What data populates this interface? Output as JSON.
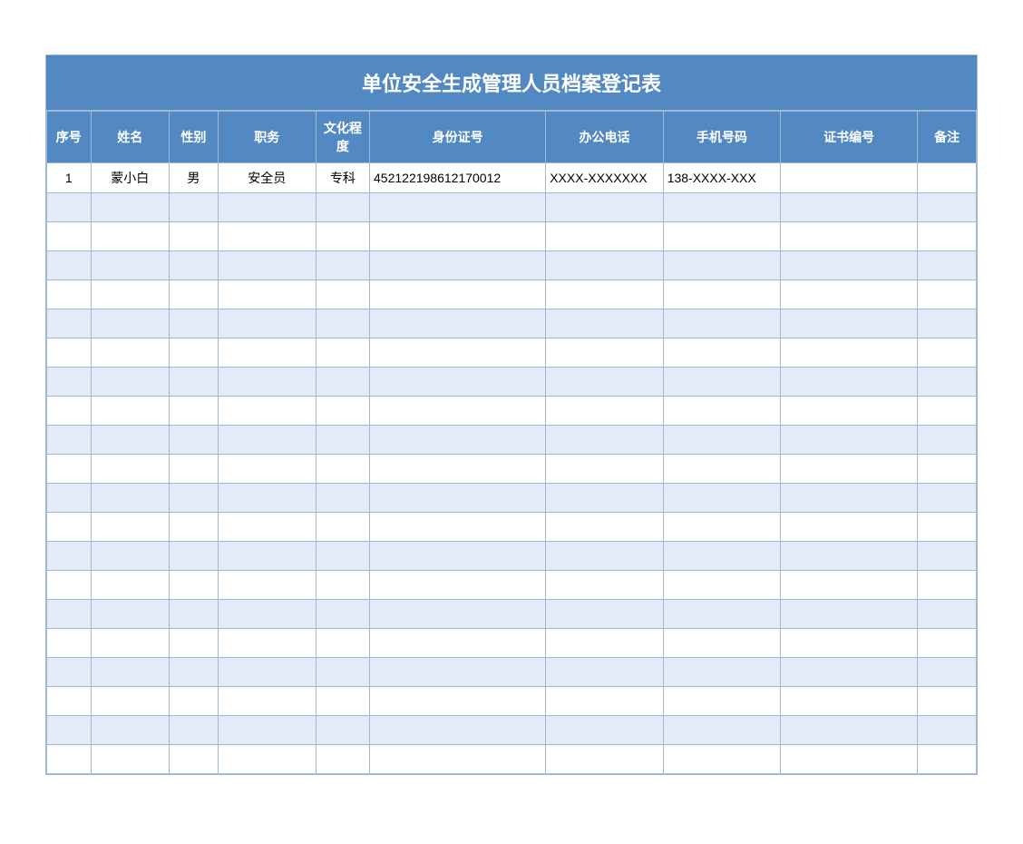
{
  "title": "单位安全生成管理人员档案登记表",
  "columns": [
    "序号",
    "姓名",
    "性别",
    "职务",
    "文化程度",
    "身份证号",
    "办公电话",
    "手机号码",
    "证书编号",
    "备注"
  ],
  "rows": [
    {
      "seq": "1",
      "name": "蒙小白",
      "gender": "男",
      "position": "安全员",
      "education": "专科",
      "id_number": "452122198612170012",
      "office_phone": "XXXX-XXXXXXX",
      "mobile": "138-XXXX-XXX",
      "cert_no": "",
      "note": ""
    },
    {
      "seq": "",
      "name": "",
      "gender": "",
      "position": "",
      "education": "",
      "id_number": "",
      "office_phone": "",
      "mobile": "",
      "cert_no": "",
      "note": ""
    },
    {
      "seq": "",
      "name": "",
      "gender": "",
      "position": "",
      "education": "",
      "id_number": "",
      "office_phone": "",
      "mobile": "",
      "cert_no": "",
      "note": ""
    },
    {
      "seq": "",
      "name": "",
      "gender": "",
      "position": "",
      "education": "",
      "id_number": "",
      "office_phone": "",
      "mobile": "",
      "cert_no": "",
      "note": ""
    },
    {
      "seq": "",
      "name": "",
      "gender": "",
      "position": "",
      "education": "",
      "id_number": "",
      "office_phone": "",
      "mobile": "",
      "cert_no": "",
      "note": ""
    },
    {
      "seq": "",
      "name": "",
      "gender": "",
      "position": "",
      "education": "",
      "id_number": "",
      "office_phone": "",
      "mobile": "",
      "cert_no": "",
      "note": ""
    },
    {
      "seq": "",
      "name": "",
      "gender": "",
      "position": "",
      "education": "",
      "id_number": "",
      "office_phone": "",
      "mobile": "",
      "cert_no": "",
      "note": ""
    },
    {
      "seq": "",
      "name": "",
      "gender": "",
      "position": "",
      "education": "",
      "id_number": "",
      "office_phone": "",
      "mobile": "",
      "cert_no": "",
      "note": ""
    },
    {
      "seq": "",
      "name": "",
      "gender": "",
      "position": "",
      "education": "",
      "id_number": "",
      "office_phone": "",
      "mobile": "",
      "cert_no": "",
      "note": ""
    },
    {
      "seq": "",
      "name": "",
      "gender": "",
      "position": "",
      "education": "",
      "id_number": "",
      "office_phone": "",
      "mobile": "",
      "cert_no": "",
      "note": ""
    },
    {
      "seq": "",
      "name": "",
      "gender": "",
      "position": "",
      "education": "",
      "id_number": "",
      "office_phone": "",
      "mobile": "",
      "cert_no": "",
      "note": ""
    },
    {
      "seq": "",
      "name": "",
      "gender": "",
      "position": "",
      "education": "",
      "id_number": "",
      "office_phone": "",
      "mobile": "",
      "cert_no": "",
      "note": ""
    },
    {
      "seq": "",
      "name": "",
      "gender": "",
      "position": "",
      "education": "",
      "id_number": "",
      "office_phone": "",
      "mobile": "",
      "cert_no": "",
      "note": ""
    },
    {
      "seq": "",
      "name": "",
      "gender": "",
      "position": "",
      "education": "",
      "id_number": "",
      "office_phone": "",
      "mobile": "",
      "cert_no": "",
      "note": ""
    },
    {
      "seq": "",
      "name": "",
      "gender": "",
      "position": "",
      "education": "",
      "id_number": "",
      "office_phone": "",
      "mobile": "",
      "cert_no": "",
      "note": ""
    },
    {
      "seq": "",
      "name": "",
      "gender": "",
      "position": "",
      "education": "",
      "id_number": "",
      "office_phone": "",
      "mobile": "",
      "cert_no": "",
      "note": ""
    },
    {
      "seq": "",
      "name": "",
      "gender": "",
      "position": "",
      "education": "",
      "id_number": "",
      "office_phone": "",
      "mobile": "",
      "cert_no": "",
      "note": ""
    },
    {
      "seq": "",
      "name": "",
      "gender": "",
      "position": "",
      "education": "",
      "id_number": "",
      "office_phone": "",
      "mobile": "",
      "cert_no": "",
      "note": ""
    },
    {
      "seq": "",
      "name": "",
      "gender": "",
      "position": "",
      "education": "",
      "id_number": "",
      "office_phone": "",
      "mobile": "",
      "cert_no": "",
      "note": ""
    },
    {
      "seq": "",
      "name": "",
      "gender": "",
      "position": "",
      "education": "",
      "id_number": "",
      "office_phone": "",
      "mobile": "",
      "cert_no": "",
      "note": ""
    },
    {
      "seq": "",
      "name": "",
      "gender": "",
      "position": "",
      "education": "",
      "id_number": "",
      "office_phone": "",
      "mobile": "",
      "cert_no": "",
      "note": ""
    }
  ]
}
